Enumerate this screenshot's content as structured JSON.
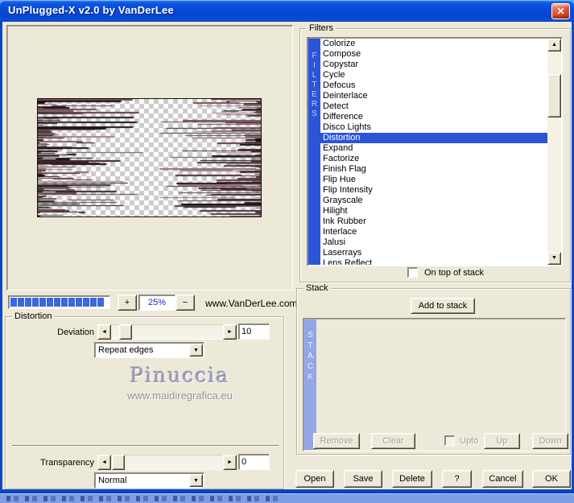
{
  "window": {
    "title": "UnPlugged-X v2.0 by VanDerLee"
  },
  "glyphs": {
    "close": "✕",
    "left": "◄",
    "right": "►",
    "up": "▲",
    "down": "▼",
    "dropdown": "▼"
  },
  "zoom": {
    "plus": "+",
    "value": "25%",
    "minus": "−",
    "brand": "www.VanDerLee.com",
    "progress_blocks": 13
  },
  "distortion": {
    "group_label": "Distortion",
    "deviation_label": "Deviation",
    "deviation_value": "10",
    "edge_mode": "Repeat edges",
    "transparency_label": "Transparency",
    "transparency_value": "0",
    "blend_mode": "Normal"
  },
  "watermark": {
    "name": "Pinuccia",
    "site": "www.maidiregrafica.eu"
  },
  "filters": {
    "group_label": "Filters",
    "strip": "FILTERS",
    "items": [
      "Colorize",
      "Compose",
      "Copystar",
      "Cycle",
      "Defocus",
      "Deinterlace",
      "Detect",
      "Difference",
      "Disco Lights",
      "Distortion",
      "Expand",
      "Factorize",
      "Finish Flag",
      "Flip Hue",
      "Flip Intensity",
      "Grayscale",
      "Hilight",
      "Ink Rubber",
      "Interlace",
      "Jalusi",
      "Laserrays",
      "Lens Reflect"
    ],
    "selected_item": "Distortion",
    "on_top_label": "On top of stack"
  },
  "stack": {
    "group_label": "Stack",
    "strip": "STACK",
    "add_button": "Add to stack",
    "remove_button": "Remove",
    "clear_button": "Clear",
    "upto_label": "Upto",
    "up_button": "Up",
    "down_button": "Down"
  },
  "actions": {
    "open": "Open",
    "save": "Save",
    "delete": "Delete",
    "help": "?",
    "cancel": "Cancel",
    "ok": "OK"
  },
  "colors": {
    "selection_blue": "#2b55d6",
    "stack_strip_blue": "#93a6e8",
    "progress_blue": "#3a68de",
    "titlebar_blue": "#0747d6",
    "client_beige": "#ece9d8"
  }
}
